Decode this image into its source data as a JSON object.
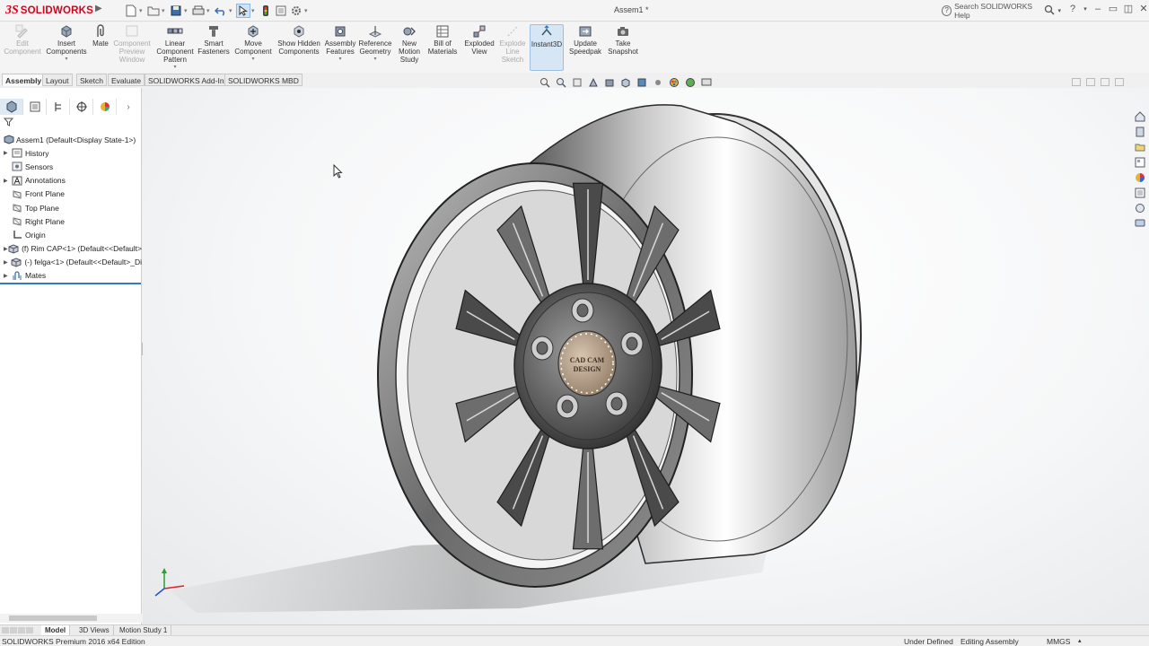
{
  "app": {
    "brand_ds": "3S",
    "brand_name": "SOLIDWORKS",
    "document_title": "Assem1 *"
  },
  "search": {
    "placeholder": "Search SOLIDWORKS Help"
  },
  "command_manager": {
    "edit_component": "Edit Component",
    "insert_components": "Insert Components",
    "mate": "Mate",
    "component_preview_window": "Component Preview Window",
    "linear_component_pattern": "Linear Component Pattern",
    "smart_fasteners": "Smart Fasteners",
    "move_component": "Move Component",
    "show_hidden_components": "Show Hidden Components",
    "assembly_features": "Assembly Features",
    "reference_geometry": "Reference Geometry",
    "new_motion_study": "New Motion Study",
    "bill_of_materials": "Bill of Materials",
    "exploded_view": "Exploded View",
    "explode_line_sketch": "Explode Line Sketch",
    "instant3d": "Instant3D",
    "update_speedpak": "Update Speedpak",
    "take_snapshot": "Take Snapshot"
  },
  "tabs": {
    "assembly": "Assembly",
    "layout": "Layout",
    "sketch": "Sketch",
    "evaluate": "Evaluate",
    "addins": "SOLIDWORKS Add-Ins",
    "mbd": "SOLIDWORKS MBD"
  },
  "feature_tree": {
    "root": "Assem1  (Default<Display State-1>)",
    "history": "History",
    "sensors": "Sensors",
    "annotations": "Annotations",
    "front_plane": "Front Plane",
    "top_plane": "Top Plane",
    "right_plane": "Right Plane",
    "origin": "Origin",
    "rim_cap": "(f) Rim CAP<1> (Default<<Default>",
    "felga": "(-) felga<1> (Default<<Default>_Di",
    "mates": "Mates"
  },
  "model": {
    "hub_label_line1": "CAD CAM",
    "hub_label_line2": "DESIGN"
  },
  "bottom_tabs": {
    "model": "Model",
    "views_3d": "3D Views",
    "motion_study": "Motion Study 1"
  },
  "status": {
    "edition": "SOLIDWORKS Premium 2016 x64 Edition",
    "definition": "Under Defined",
    "mode": "Editing Assembly",
    "units": "MMGS"
  },
  "colors": {
    "brand_red": "#d6001c",
    "selection_blue": "#2f7bc6"
  }
}
